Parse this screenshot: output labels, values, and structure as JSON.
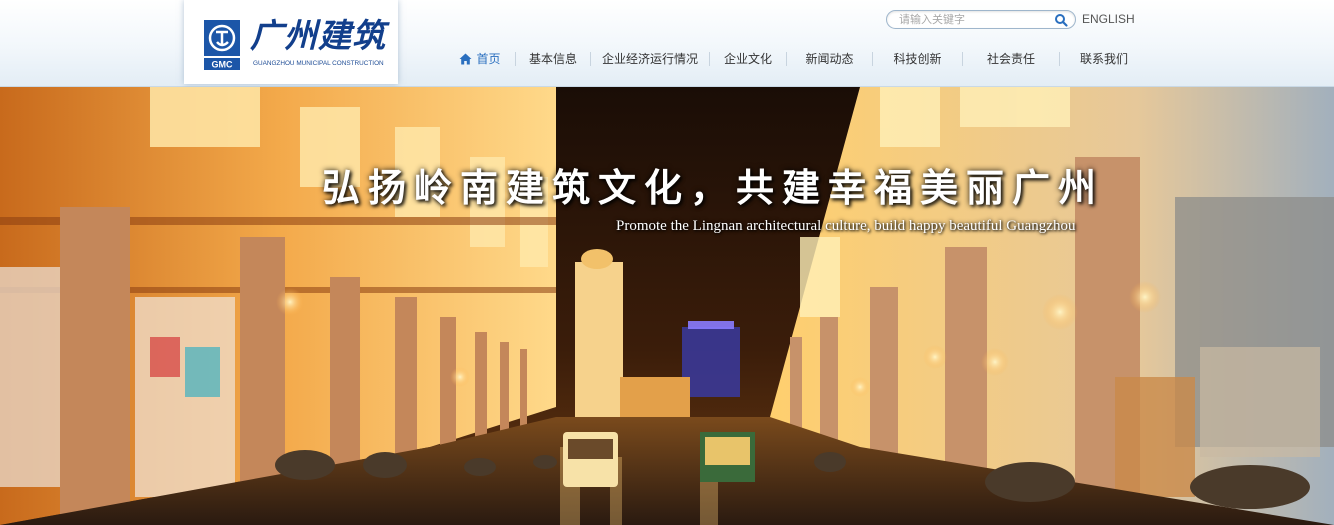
{
  "brand": {
    "name_cn": "广州建筑",
    "name_en": "GUANGZHOU MUNICIPAL CONSTRUCTION",
    "mark_text": "GMC"
  },
  "search": {
    "placeholder": "请输入关键字",
    "icon": "search-icon"
  },
  "language_link": "ENGLISH",
  "nav": {
    "items": [
      {
        "label": "首页",
        "icon": "home-icon",
        "active": true
      },
      {
        "label": "基本信息"
      },
      {
        "label": "企业经济运行情况"
      },
      {
        "label": "企业文化"
      },
      {
        "label": "新闻动态"
      },
      {
        "label": "科技创新"
      },
      {
        "label": "社会责任"
      },
      {
        "label": "联系我们"
      }
    ]
  },
  "banner": {
    "slogan_cn": "弘扬岭南建筑文化，共建幸福美丽广州",
    "slogan_en": "Promote the Lingnan architectural culture, build happy beautiful Guangzhou"
  },
  "colors": {
    "brand_blue": "#123f8c",
    "nav_active": "#2a6fbf",
    "header_bg": "#eaf2f8"
  }
}
